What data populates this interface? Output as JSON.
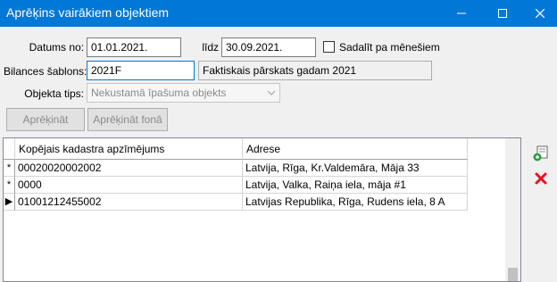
{
  "window": {
    "title": "Aprēķins vairākiem objektiem"
  },
  "form": {
    "date_label": "Datums no:",
    "date_from": "01.01.2021.",
    "until_label": "līdz",
    "date_to": "30.09.2021.",
    "split_label": "Sadalīt pa mēnešiem",
    "split_checked": false,
    "template_label": "Bilances šablons:",
    "template_code": "2021F",
    "template_name": "Faktiskais pārskats gadam 2021",
    "object_type_label": "Objekta tips:",
    "object_type_value": "Nekustamā īpašuma objekts"
  },
  "buttons": {
    "calculate": "Aprēķināt",
    "calculate_background": "Aprēķināt fonā"
  },
  "table": {
    "columns": [
      "Kopējais kadastra apzīmējums",
      "Adrese"
    ],
    "rows": [
      {
        "marker": "*",
        "code": "00020020002002",
        "address": "Latvija, Rīga, Kr.Valdemāra, Māja 33"
      },
      {
        "marker": "*",
        "code": "0000",
        "address": "Latvija, Valka, Raiņa iela, māja #1"
      },
      {
        "marker": "▶",
        "code": "01001212455002",
        "address": "Latvijas Republika, Rīga, Rudens iela, 8 A"
      }
    ]
  },
  "icons": {
    "add": "add-record-icon",
    "delete": "delete-icon"
  },
  "colors": {
    "titlebar": "#0078d7",
    "delete": "#e81123",
    "add": "#2e9e3e"
  }
}
